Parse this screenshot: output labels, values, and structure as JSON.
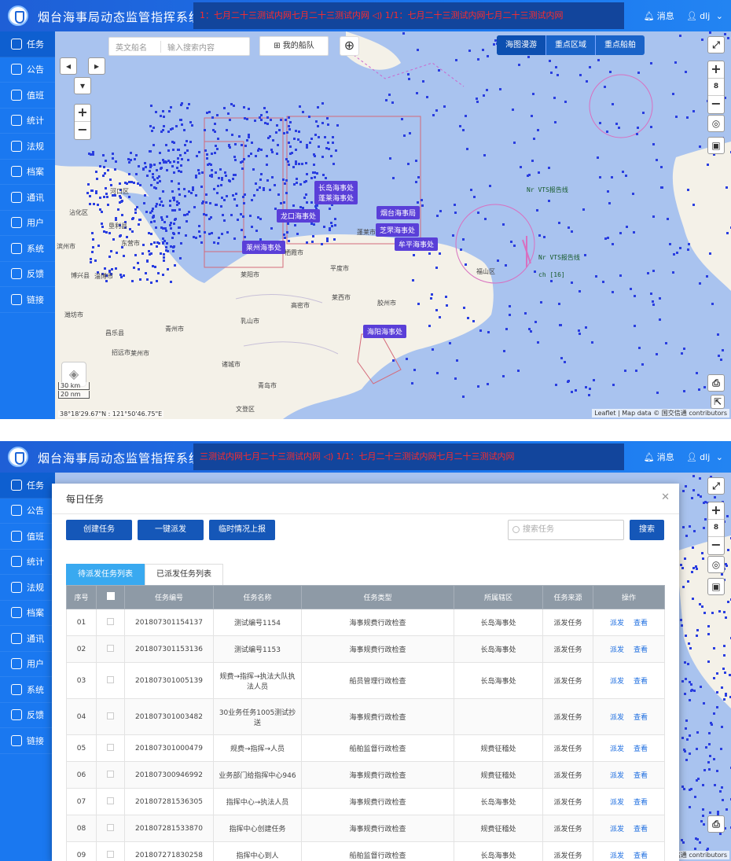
{
  "app": {
    "title": "烟台海事局动态监管指挥系统",
    "ticker_top": "1：七月二十三测试内网七月二十三测试内网 ◁) 1/1：七月二十三测试内网七月二十三测试内网",
    "ticker_bottom": "三测试内网七月二十三测试内网 ◁) 1/1：七月二十三测试内网七月二十三测试内网",
    "messages_label": "消息",
    "user_label": "dlj"
  },
  "sidebar": {
    "items": [
      {
        "label": "任务",
        "icon": "task-icon"
      },
      {
        "label": "公告",
        "icon": "megaphone-icon"
      },
      {
        "label": "值班",
        "icon": "duty-icon"
      },
      {
        "label": "统计",
        "icon": "pie-chart-icon"
      },
      {
        "label": "法规",
        "icon": "book-icon"
      },
      {
        "label": "档案",
        "icon": "archive-icon"
      },
      {
        "label": "通讯",
        "icon": "contacts-icon"
      },
      {
        "label": "用户",
        "icon": "user-icon"
      },
      {
        "label": "系统",
        "icon": "settings-icon"
      },
      {
        "label": "反馈",
        "icon": "mail-icon"
      },
      {
        "label": "链接",
        "icon": "link-icon"
      }
    ]
  },
  "map": {
    "search_select": "英文船名",
    "search_placeholder": "输入搜索内容",
    "fleet_button": "我的船队",
    "modes": [
      "海图漫游",
      "重点区域",
      "重点船舶"
    ],
    "zoom_level": "8",
    "scale_km": "30 km",
    "scale_nm": "20 nm",
    "coordinates": "38°18'29.67\"N : 121°50'46.75\"E",
    "attribution": "Leaflet | Map data © 国交信通 contributors",
    "attribution_short": "信通 contributors",
    "offices": [
      "长岛海事处",
      "蓬莱海事处",
      "龙口海事处",
      "烟台海事局",
      "芝罘海事处",
      "莱州海事处",
      "牟平海事处",
      "海阳海事处"
    ],
    "places": [
      "河口区",
      "沾化区",
      "垦利县",
      "东营市",
      "滨州市",
      "博兴县",
      "淄博市",
      "潍坊市",
      "青州市",
      "昌乐县",
      "招远市",
      "莱州市",
      "栖霞市",
      "莱阳市",
      "平度市",
      "莱西市",
      "乳山市",
      "高密市",
      "胶州市",
      "诸城市",
      "青岛市",
      "文登区",
      "福山区",
      "蓬莱市"
    ],
    "vts_labels": [
      "Nr VTS报告线",
      "ch [16]"
    ]
  },
  "modal": {
    "title": "每日任务",
    "buttons": [
      "创建任务",
      "一键派发",
      "临时情况上报"
    ],
    "search_placeholder": "搜索任务",
    "search_button": "搜索",
    "tabs": [
      "待派发任务列表",
      "已派发任务列表"
    ],
    "columns": [
      "序号",
      "",
      "任务编号",
      "任务名称",
      "任务类型",
      "所属辖区",
      "任务来源",
      "操作"
    ],
    "action_dispatch": "派发",
    "action_view": "查看",
    "rows": [
      {
        "no": "01",
        "code": "201807301154137",
        "name": "测试编号1154",
        "type": "海事规费行政检查",
        "area": "长岛海事处",
        "source": "派发任务"
      },
      {
        "no": "02",
        "code": "201807301153136",
        "name": "测试编号1153",
        "type": "海事规费行政检查",
        "area": "长岛海事处",
        "source": "派发任务"
      },
      {
        "no": "03",
        "code": "201807301005139",
        "name": "规费→指挥→执法大队执法人员",
        "type": "船员管理行政检查",
        "area": "长岛海事处",
        "source": "派发任务"
      },
      {
        "no": "04",
        "code": "201807301003482",
        "name": "30业务任务1005测试抄送",
        "type": "海事规费行政检查",
        "area": "",
        "source": "派发任务"
      },
      {
        "no": "05",
        "code": "201807301000479",
        "name": "规费→指挥→人员",
        "type": "船舶监督行政检查",
        "area": "规费征稽处",
        "source": "派发任务"
      },
      {
        "no": "06",
        "code": "201807300946992",
        "name": "业务部门给指挥中心946",
        "type": "海事规费行政检查",
        "area": "规费征稽处",
        "source": "派发任务"
      },
      {
        "no": "07",
        "code": "201807281536305",
        "name": "指挥中心→执法人员",
        "type": "海事规费行政检查",
        "area": "长岛海事处",
        "source": "派发任务"
      },
      {
        "no": "08",
        "code": "201807281533870",
        "name": "指挥中心创建任务",
        "type": "海事规费行政检查",
        "area": "规费征稽处",
        "source": "派发任务"
      },
      {
        "no": "09",
        "code": "201807271830258",
        "name": "指挥中心到人",
        "type": "船舶监督行政检查",
        "area": "长岛海事处",
        "source": "派发任务"
      }
    ]
  },
  "colors": {
    "header": "#1a78f0",
    "sidebar": "#1a78f0",
    "sea": "#a9c3ef",
    "ship_dot": "#2a3ee0",
    "office_label": "#5a3fd8",
    "table_header": "#8e9aa6"
  }
}
